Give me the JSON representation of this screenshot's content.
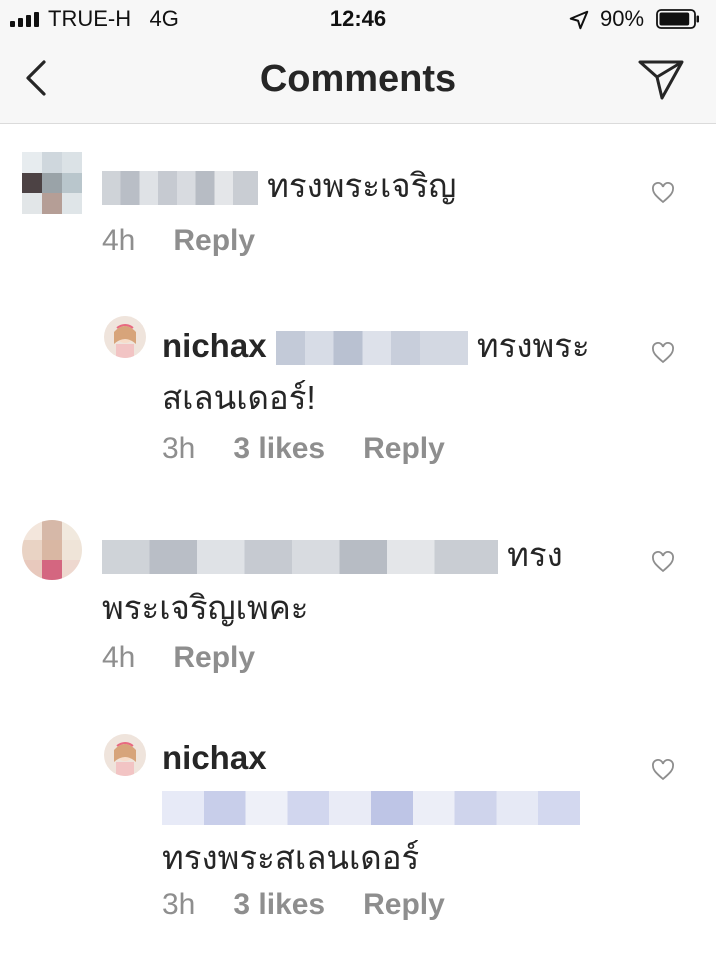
{
  "status_bar": {
    "carrier": "TRUE-H",
    "network": "4G",
    "time": "12:46",
    "battery": "90%",
    "battery_level": 0.9
  },
  "nav": {
    "title": "Comments"
  },
  "comments": [
    {
      "username": "",
      "text": "ทรงพระเจริญ",
      "time": "4h",
      "likes": "",
      "reply": "Reply"
    },
    {
      "username": "nichax",
      "text_line1": "ทรงพระ",
      "text_line2": "สเลนเดอร์!",
      "time": "3h",
      "likes": "3 likes",
      "reply": "Reply"
    },
    {
      "username": "",
      "text_line1": "ทรง",
      "text_line2": "พระเจริญเพคะ",
      "time": "4h",
      "likes": "",
      "reply": "Reply"
    },
    {
      "username": "nichax",
      "text": "ทรงพระสเลนเดอร์",
      "time": "3h",
      "likes": "3 likes",
      "reply": "Reply"
    }
  ],
  "icons": {
    "back": "chevron-left-icon",
    "send": "paper-plane-icon",
    "like": "heart-icon",
    "location": "location-arrow-icon"
  },
  "colors": {
    "text": "#262626",
    "secondary": "#8e8e8e",
    "bar": "#f7f7f7"
  }
}
